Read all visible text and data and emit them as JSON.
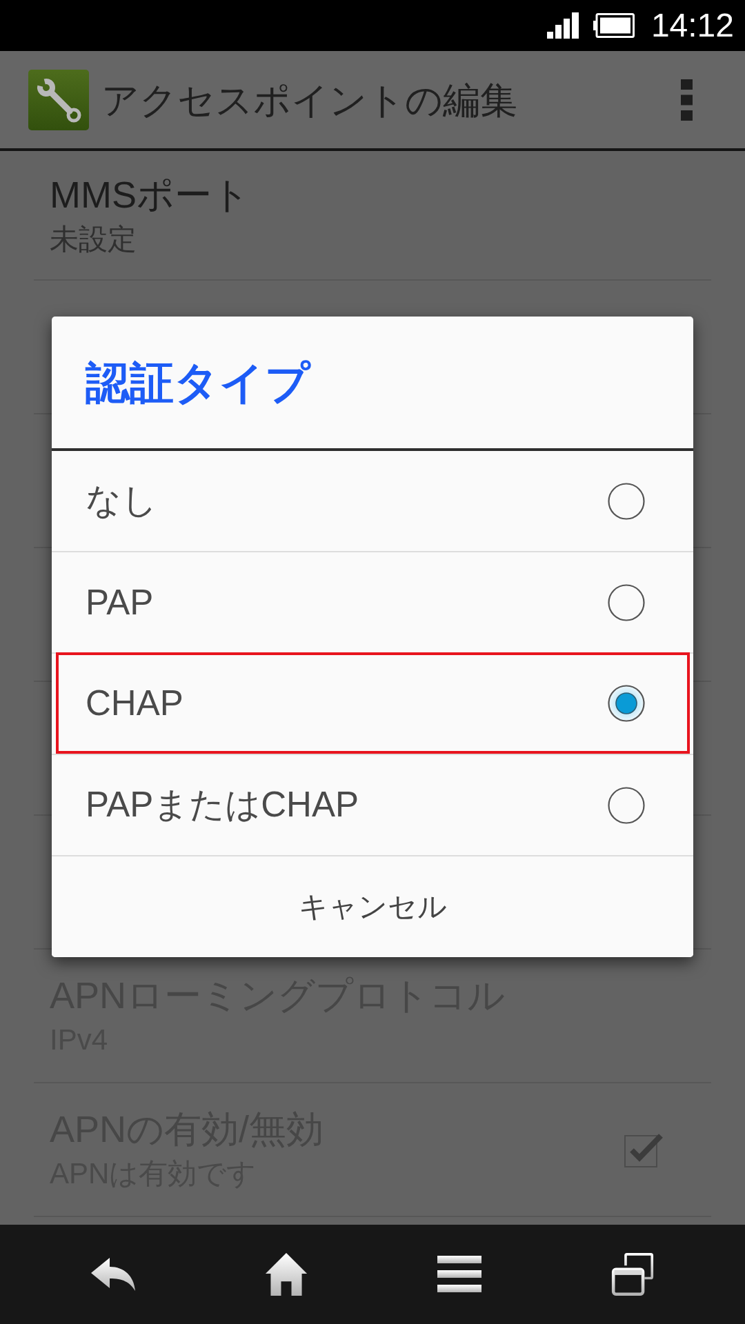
{
  "status_bar": {
    "time": "14:12"
  },
  "action_bar": {
    "title": "アクセスポイントの編集"
  },
  "settings": [
    {
      "kind": "text",
      "title": "MMSポート",
      "summary": "未設定",
      "disabled": false
    },
    {
      "kind": "text",
      "title": "APNローミングプロトコル",
      "summary": "IPv4",
      "disabled": true
    },
    {
      "kind": "checkbox",
      "title": "APNの有効/無効",
      "summary": "APNは有効です",
      "disabled": true,
      "checked": true
    }
  ],
  "dialog": {
    "title": "認証タイプ",
    "options": [
      {
        "label": "なし",
        "selected": false,
        "highlighted": false
      },
      {
        "label": "PAP",
        "selected": false,
        "highlighted": false
      },
      {
        "label": "CHAP",
        "selected": true,
        "highlighted": true
      },
      {
        "label": "PAPまたはCHAP",
        "selected": false,
        "highlighted": false
      }
    ],
    "cancel": "キャンセル"
  }
}
